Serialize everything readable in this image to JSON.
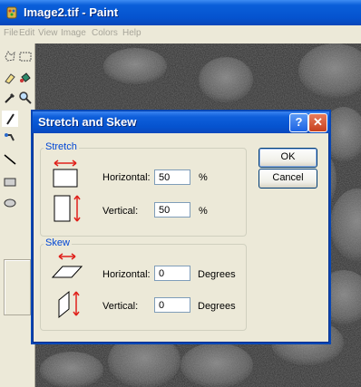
{
  "window": {
    "title": "Image2.tif - Paint"
  },
  "menu": [
    "File",
    "Edit",
    "View",
    "Image",
    "Colors",
    "Help"
  ],
  "dialog": {
    "title": "Stretch and Skew",
    "help_glyph": "?",
    "close_glyph": "✕",
    "stretch": {
      "label": "Stretch",
      "horizontal_label": "Horizontal:",
      "horizontal_value": "50",
      "horizontal_unit": "%",
      "vertical_label": "Vertical:",
      "vertical_value": "50",
      "vertical_unit": "%"
    },
    "skew": {
      "label": "Skew",
      "horizontal_label": "Horizontal:",
      "horizontal_value": "0",
      "horizontal_unit": "Degrees",
      "vertical_label": "Vertical:",
      "vertical_value": "0",
      "vertical_unit": "Degrees"
    },
    "ok_label": "OK",
    "cancel_label": "Cancel"
  },
  "colors": {
    "titlebar": "#0553cf",
    "dialog_bg": "#ece9d8",
    "group_label": "#0046d5",
    "arrow_red": "#e0201a"
  },
  "icons": [
    "paint-app-icon",
    "free-select-icon",
    "rect-select-icon",
    "eraser-icon",
    "fill-icon",
    "color-picker-icon",
    "magnifier-icon",
    "pencil-icon",
    "brush-icon",
    "line-icon",
    "rectangle-icon",
    "ellipse-icon"
  ]
}
